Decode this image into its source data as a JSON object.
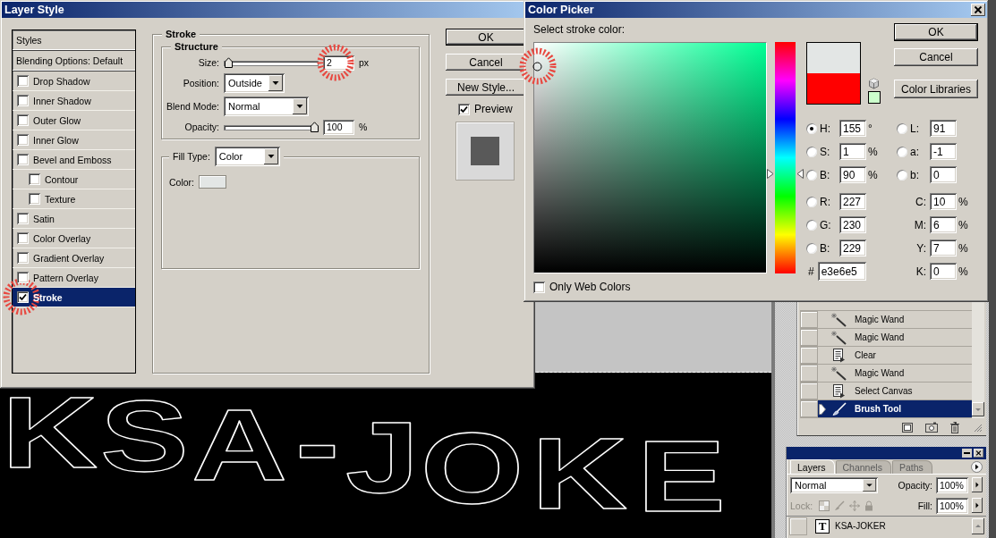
{
  "layer_style": {
    "title": "Layer Style",
    "styles": [
      {
        "label": "Styles",
        "kind": "heading",
        "selected": false
      },
      {
        "label": "Blending Options: Default",
        "kind": "heading",
        "selected": false
      },
      {
        "label": "Drop Shadow",
        "kind": "effect",
        "checked": false,
        "selected": false
      },
      {
        "label": "Inner Shadow",
        "kind": "effect",
        "checked": false,
        "selected": false
      },
      {
        "label": "Outer Glow",
        "kind": "effect",
        "checked": false,
        "selected": false
      },
      {
        "label": "Inner Glow",
        "kind": "effect",
        "checked": false,
        "selected": false
      },
      {
        "label": "Bevel and Emboss",
        "kind": "effect",
        "checked": false,
        "selected": false,
        "children": [
          {
            "label": "Contour",
            "kind": "effect",
            "checked": false,
            "selected": false
          },
          {
            "label": "Texture",
            "kind": "effect",
            "checked": false,
            "selected": false
          }
        ]
      },
      {
        "label": "Satin",
        "kind": "effect",
        "checked": false,
        "selected": false
      },
      {
        "label": "Color Overlay",
        "kind": "effect",
        "checked": false,
        "selected": false
      },
      {
        "label": "Gradient Overlay",
        "kind": "effect",
        "checked": false,
        "selected": false
      },
      {
        "label": "Pattern Overlay",
        "kind": "effect",
        "checked": false,
        "selected": false
      },
      {
        "label": "Stroke",
        "kind": "effect",
        "checked": true,
        "selected": true
      }
    ],
    "stroke": {
      "title": "Stroke",
      "structure": {
        "title": "Structure",
        "size": {
          "label": "Size:",
          "level": 0.01,
          "value": "2",
          "unit": "px"
        },
        "position": {
          "label": "Position:",
          "value": "Outside"
        },
        "blend_mode": {
          "label": "Blend Mode:",
          "value": "Normal"
        },
        "opacity": {
          "label": "Opacity:",
          "level": 1,
          "value": "100",
          "unit": "%"
        }
      },
      "fill": {
        "label": "Fill Type:",
        "value": "Color",
        "color_label": "Color:"
      }
    },
    "buttons": [
      {
        "label": "OK",
        "default": true
      },
      {
        "label": "Cancel",
        "default": false
      },
      {
        "label": "New Style...",
        "default": false
      }
    ],
    "preview": {
      "label": "Preview",
      "checked": true
    }
  },
  "color_picker": {
    "title": "Color Picker",
    "prompt": "Select stroke color:",
    "hue_slider": {
      "level": 0.43
    },
    "swatches": [
      {
        "kind": "new",
        "color": "#e3e6e5"
      },
      {
        "kind": "current",
        "color": "#ff0000"
      }
    ],
    "buttons": [
      {
        "label": "OK",
        "default": true
      },
      {
        "label": "Cancel",
        "default": false
      },
      {
        "label": "Color Libraries",
        "default": false
      }
    ],
    "hsb": [
      {
        "label": "H:",
        "value": "155",
        "unit": "°",
        "selected": true
      },
      {
        "label": "S:",
        "value": "1",
        "unit": "%",
        "selected": false
      },
      {
        "label": "B:",
        "value": "90",
        "unit": "%",
        "selected": false
      }
    ],
    "rgb": [
      {
        "label": "R:",
        "value": "227",
        "selected": false
      },
      {
        "label": "G:",
        "value": "230",
        "selected": false
      },
      {
        "label": "B:",
        "value": "229",
        "selected": false
      }
    ],
    "hex": {
      "label": "#",
      "value": "e3e6e5"
    },
    "lab": [
      {
        "label": "L:",
        "value": "91",
        "selected": false
      },
      {
        "label": "a:",
        "value": "-1",
        "selected": false
      },
      {
        "label": "b:",
        "value": "0",
        "selected": false
      }
    ],
    "cmyk": [
      {
        "label": "C:",
        "value": "10",
        "unit": "%"
      },
      {
        "label": "M:",
        "value": "6",
        "unit": "%"
      },
      {
        "label": "Y:",
        "value": "7",
        "unit": "%"
      },
      {
        "label": "K:",
        "value": "0",
        "unit": "%"
      }
    ],
    "web_colors": {
      "label": "Only Web Colors",
      "checked": false
    }
  },
  "history": {
    "items": [
      {
        "label": "Magic Wand",
        "kind": "wand",
        "selected": false
      },
      {
        "label": "Magic Wand",
        "kind": "wand",
        "selected": false
      },
      {
        "label": "Clear",
        "kind": "command",
        "selected": false
      },
      {
        "label": "Magic Wand",
        "kind": "wand",
        "selected": false
      },
      {
        "label": "Select Canvas",
        "kind": "command",
        "selected": false
      },
      {
        "label": "Brush Tool",
        "kind": "brush",
        "selected": true
      }
    ]
  },
  "layers_panel": {
    "tabs": [
      {
        "label": "Layers",
        "selected": true
      },
      {
        "label": "Channels",
        "selected": false
      },
      {
        "label": "Paths",
        "selected": false
      }
    ],
    "blend_mode": "Normal",
    "opacity": {
      "label": "Opacity:",
      "value": "100%"
    },
    "lock": {
      "label": "Lock:",
      "disabled": true
    },
    "fill": {
      "label": "Fill:",
      "value": "100%"
    },
    "layers": [
      {
        "name": "KSA-JOKER",
        "kind": "text",
        "badge": "T"
      }
    ]
  },
  "canvas": {
    "text": "KSA-JOKE"
  }
}
